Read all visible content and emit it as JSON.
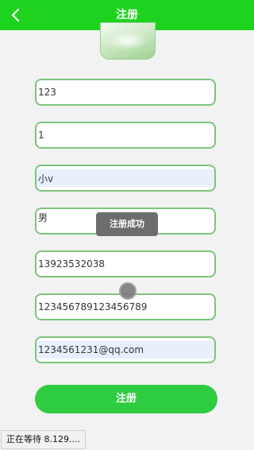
{
  "header": {
    "title": "注册",
    "back_icon": "chevron-left-icon"
  },
  "form": {
    "account": "123",
    "password": "1",
    "nickname": "小v",
    "gender": "男",
    "phone": "13923532038",
    "id_number": "123456789123456789",
    "email": "1234561231@qq.com"
  },
  "toast": {
    "message": "注册成功"
  },
  "submit_label": "注册",
  "status_bar": {
    "text": "正在等待 8.129...."
  },
  "colors": {
    "accent": "#1ed31e",
    "button": "#2ecc40",
    "field_border": "#7cc47c"
  }
}
